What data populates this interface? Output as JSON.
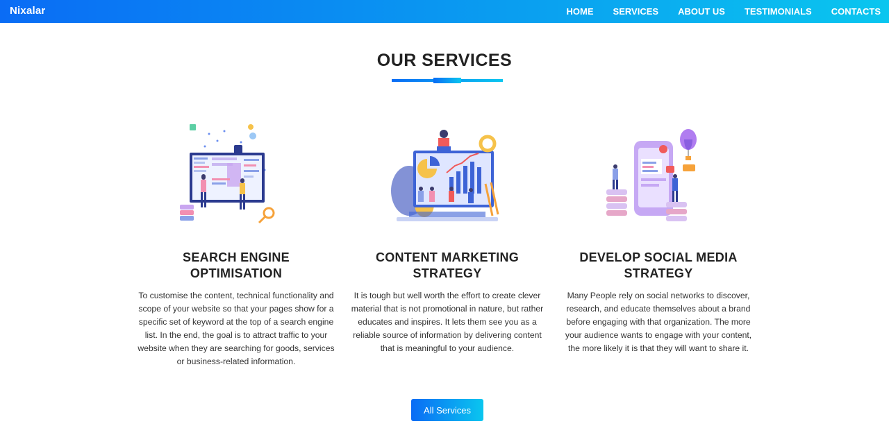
{
  "header": {
    "brand": "Nixalar",
    "nav": [
      "HOME",
      "SERVICES",
      "ABOUT US",
      "TESTIMONIALS",
      "CONTACTS"
    ]
  },
  "section": {
    "title": "OUR SERVICES"
  },
  "services": [
    {
      "title_line1": "SEARCH ENGINE",
      "title_line2": "OPTIMISATION",
      "description": "To customise the content, technical functionality and scope of your website so that your pages show for a specific set of keyword at the top of a search engine list. In the end, the goal is to attract traffic to your website when they are searching for goods, services or business-related information."
    },
    {
      "title_line1": "CONTENT MARKETING",
      "title_line2": "STRATEGY",
      "description": "It is tough but well worth the effort to create clever material that is not promotional in nature, but rather educates and inspires. It lets them see you as a reliable source of information by delivering content that is meaningful to your audience."
    },
    {
      "title_line1": "DEVELOP SOCIAL MEDIA",
      "title_line2": "STRATEGY",
      "description": "Many People rely on social networks to discover, research, and educate themselves about a brand before engaging with that organization. The more your audience wants to engage with your content, the more likely it is that they will want to share it."
    }
  ],
  "cta": {
    "label": "All Services"
  },
  "colors": {
    "gradient_start": "#0a6cf5",
    "gradient_end": "#0ac6ef"
  }
}
